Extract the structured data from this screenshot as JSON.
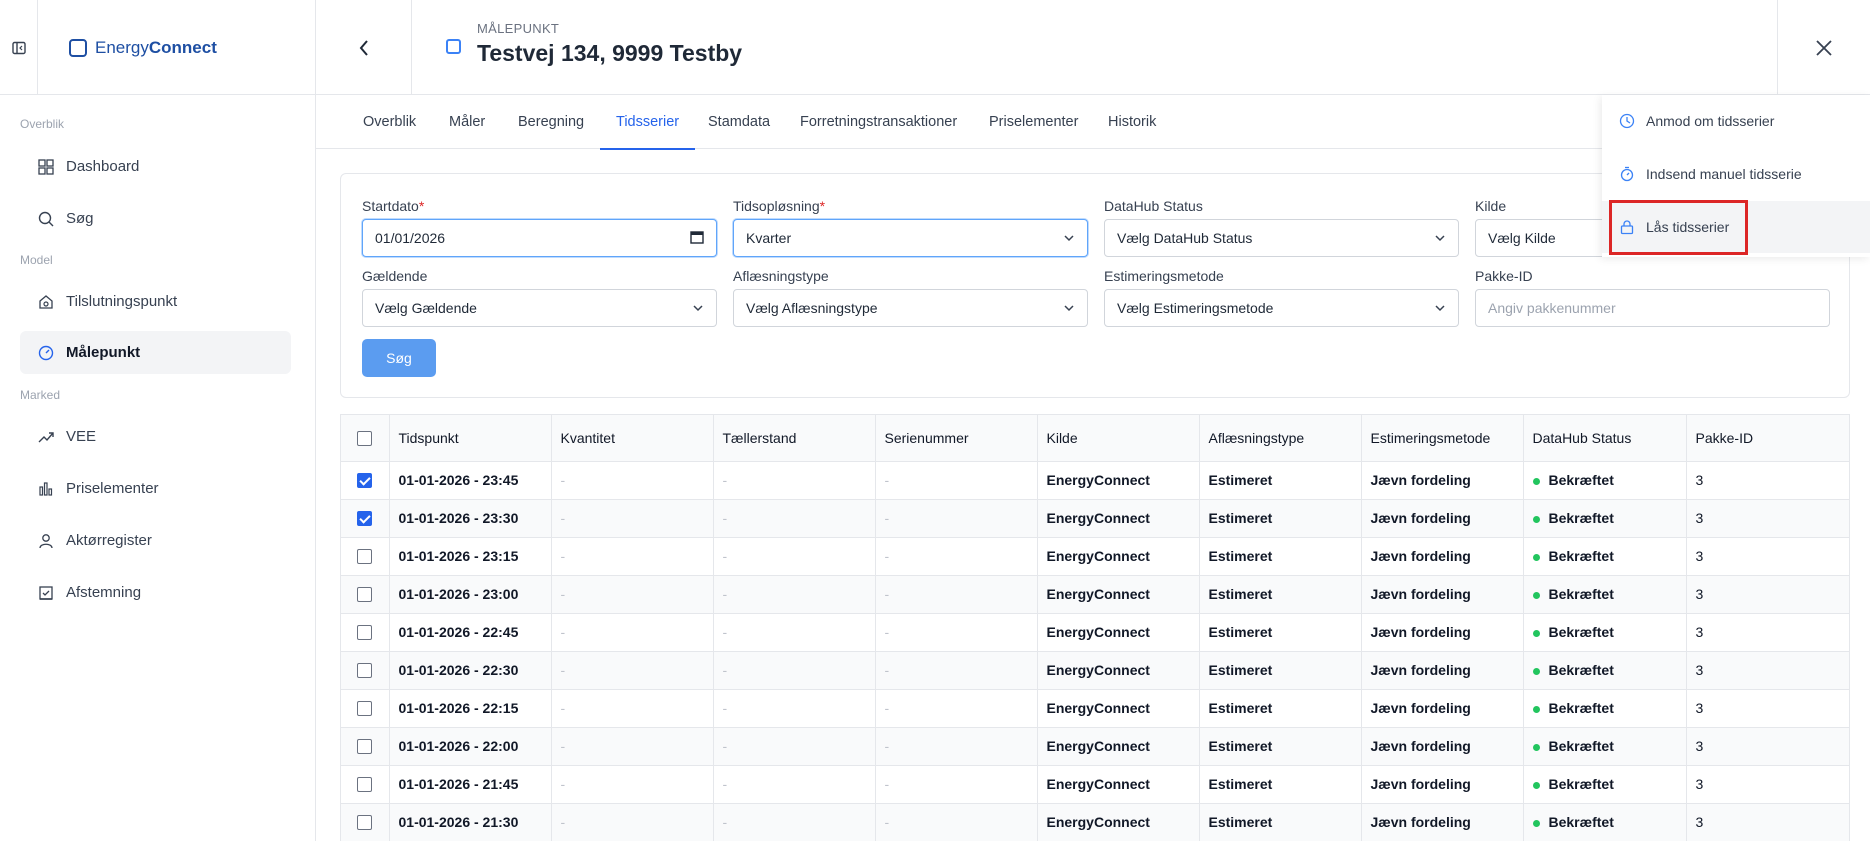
{
  "brand": {
    "name_light": "Energy",
    "name_bold": "Connect"
  },
  "header": {
    "eyebrow": "MÅLEPUNKT",
    "title": "Testvej 134, 9999 Testby"
  },
  "sidebar": {
    "sections": [
      "Overblik",
      "Model",
      "Marked"
    ],
    "items": [
      {
        "label": "Dashboard",
        "icon": "dashboard-icon"
      },
      {
        "label": "Søg",
        "icon": "search-icon"
      },
      {
        "label": "Tilslutningspunkt",
        "icon": "home-icon"
      },
      {
        "label": "Målepunkt",
        "icon": "gauge-icon",
        "active": true
      },
      {
        "label": "VEE",
        "icon": "trend-icon"
      },
      {
        "label": "Priselementer",
        "icon": "bar-chart-icon"
      },
      {
        "label": "Aktørregister",
        "icon": "user-icon"
      },
      {
        "label": "Afstemning",
        "icon": "check-square-icon"
      }
    ]
  },
  "tabs": [
    "Overblik",
    "Måler",
    "Beregning",
    "Tidsserier",
    "Stamdata",
    "Forretningstransaktioner",
    "Priselementer",
    "Historik"
  ],
  "active_tab": "Tidsserier",
  "filters": {
    "startdato": {
      "label": "Startdato",
      "value": "01/01/2026"
    },
    "tidsoplosning": {
      "label": "Tidsopløsning",
      "value": "Kvarter"
    },
    "datahub_status": {
      "label": "DataHub Status",
      "value": "Vælg DataHub Status"
    },
    "kilde": {
      "label": "Kilde",
      "value": "Vælg Kilde"
    },
    "gaeldende": {
      "label": "Gældende",
      "value": "Vælg Gældende"
    },
    "aflaesningstype": {
      "label": "Aflæsningstype",
      "value": "Vælg Aflæsningstype"
    },
    "estimeringsmetode": {
      "label": "Estimeringsmetode",
      "value": "Vælg Estimeringsmetode"
    },
    "pakke_id": {
      "label": "Pakke-ID",
      "placeholder": "Angiv pakkenummer"
    },
    "search_label": "Søg"
  },
  "table": {
    "columns": [
      "Tidspunkt",
      "Kvantitet",
      "Tællerstand",
      "Serienummer",
      "Kilde",
      "Aflæsningstype",
      "Estimeringsmetode",
      "DataHub Status",
      "Pakke-ID"
    ],
    "status_color": "#22c55e",
    "rows": [
      {
        "checked": true,
        "tidspunkt": "01-01-2026 - 23:45",
        "kvantitet": "-",
        "taellerstand": "-",
        "serienummer": "-",
        "kilde": "EnergyConnect",
        "aflaesningstype": "Estimeret",
        "estimeringsmetode": "Jævn fordeling",
        "status": "Bekræftet",
        "pakke": "3"
      },
      {
        "checked": true,
        "tidspunkt": "01-01-2026 - 23:30",
        "kvantitet": "-",
        "taellerstand": "-",
        "serienummer": "-",
        "kilde": "EnergyConnect",
        "aflaesningstype": "Estimeret",
        "estimeringsmetode": "Jævn fordeling",
        "status": "Bekræftet",
        "pakke": "3"
      },
      {
        "checked": false,
        "tidspunkt": "01-01-2026 - 23:15",
        "kvantitet": "-",
        "taellerstand": "-",
        "serienummer": "-",
        "kilde": "EnergyConnect",
        "aflaesningstype": "Estimeret",
        "estimeringsmetode": "Jævn fordeling",
        "status": "Bekræftet",
        "pakke": "3"
      },
      {
        "checked": false,
        "tidspunkt": "01-01-2026 - 23:00",
        "kvantitet": "-",
        "taellerstand": "-",
        "serienummer": "-",
        "kilde": "EnergyConnect",
        "aflaesningstype": "Estimeret",
        "estimeringsmetode": "Jævn fordeling",
        "status": "Bekræftet",
        "pakke": "3"
      },
      {
        "checked": false,
        "tidspunkt": "01-01-2026 - 22:45",
        "kvantitet": "-",
        "taellerstand": "-",
        "serienummer": "-",
        "kilde": "EnergyConnect",
        "aflaesningstype": "Estimeret",
        "estimeringsmetode": "Jævn fordeling",
        "status": "Bekræftet",
        "pakke": "3"
      },
      {
        "checked": false,
        "tidspunkt": "01-01-2026 - 22:30",
        "kvantitet": "-",
        "taellerstand": "-",
        "serienummer": "-",
        "kilde": "EnergyConnect",
        "aflaesningstype": "Estimeret",
        "estimeringsmetode": "Jævn fordeling",
        "status": "Bekræftet",
        "pakke": "3"
      },
      {
        "checked": false,
        "tidspunkt": "01-01-2026 - 22:15",
        "kvantitet": "-",
        "taellerstand": "-",
        "serienummer": "-",
        "kilde": "EnergyConnect",
        "aflaesningstype": "Estimeret",
        "estimeringsmetode": "Jævn fordeling",
        "status": "Bekræftet",
        "pakke": "3"
      },
      {
        "checked": false,
        "tidspunkt": "01-01-2026 - 22:00",
        "kvantitet": "-",
        "taellerstand": "-",
        "serienummer": "-",
        "kilde": "EnergyConnect",
        "aflaesningstype": "Estimeret",
        "estimeringsmetode": "Jævn fordeling",
        "status": "Bekræftet",
        "pakke": "3"
      },
      {
        "checked": false,
        "tidspunkt": "01-01-2026 - 21:45",
        "kvantitet": "-",
        "taellerstand": "-",
        "serienummer": "-",
        "kilde": "EnergyConnect",
        "aflaesningstype": "Estimeret",
        "estimeringsmetode": "Jævn fordeling",
        "status": "Bekræftet",
        "pakke": "3"
      },
      {
        "checked": false,
        "tidspunkt": "01-01-2026 - 21:30",
        "kvantitet": "-",
        "taellerstand": "-",
        "serienummer": "-",
        "kilde": "EnergyConnect",
        "aflaesningstype": "Estimeret",
        "estimeringsmetode": "Jævn fordeling",
        "status": "Bekræftet",
        "pakke": "3"
      }
    ]
  },
  "menu": {
    "items": [
      {
        "label": "Anmod om tidsserier",
        "icon": "clock-icon"
      },
      {
        "label": "Indsend manuel tidsserie",
        "icon": "stopwatch-icon"
      },
      {
        "label": "Lås tidsserier",
        "icon": "lock-icon"
      }
    ]
  },
  "colors": {
    "accent": "#2563eb",
    "primary_button": "#5b9cf0",
    "highlight": "#dc2626"
  }
}
